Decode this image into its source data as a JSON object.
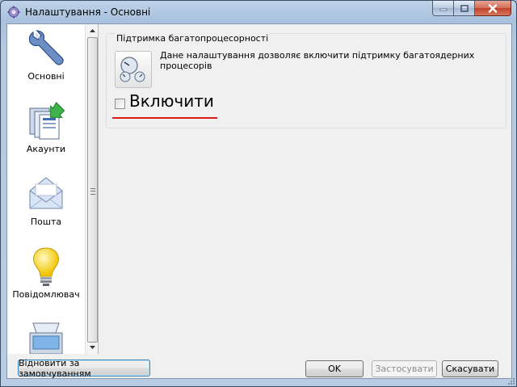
{
  "window": {
    "title": "Налаштування - Основні"
  },
  "sidebar": {
    "items": [
      {
        "label": "Основні",
        "icon": "wrench-icon"
      },
      {
        "label": "Акаунти",
        "icon": "accounts-icon"
      },
      {
        "label": "Пошта",
        "icon": "envelope-icon"
      },
      {
        "label": "Повідомлювач",
        "icon": "lightbulb-icon"
      },
      {
        "label": "",
        "icon": "scanner-icon"
      }
    ]
  },
  "group": {
    "title": "Підтримка багатопроцесорності",
    "description": "Дане налаштування дозволяє включити підтримку багатоядерних процесорів",
    "checkbox_label": "Включити",
    "checked": false
  },
  "buttons": {
    "reset": "Відновити за замовчуванням",
    "ok": "OK",
    "apply": "Застосувати",
    "cancel": "Скасувати"
  },
  "colors": {
    "underline": "#e0191b",
    "close": "#c0412a"
  }
}
